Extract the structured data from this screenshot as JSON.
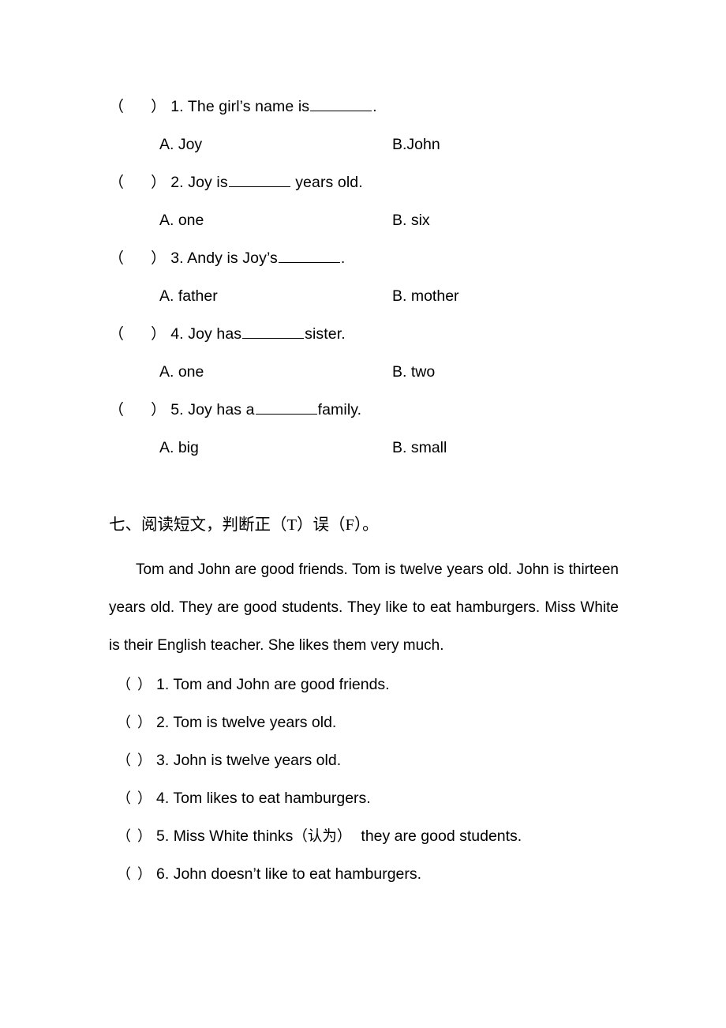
{
  "document": {
    "type": "english-exam-worksheet",
    "background_color": "#ffffff",
    "text_color": "#000000"
  },
  "multiple_choice": {
    "paren_open": "（",
    "paren_close": "）",
    "items": [
      {
        "number": "1.",
        "stem_before": "The girl’s name is",
        "stem_after": ".",
        "option_a": "A. Joy",
        "option_b": "B.John"
      },
      {
        "number": "2.",
        "stem_before": "Joy is",
        "stem_after": "years old.",
        "option_a": "A. one",
        "option_b": "B. six"
      },
      {
        "number": "3.",
        "stem_before": "Andy is Joy’s",
        "stem_after": ".",
        "option_a": "A. father",
        "option_b": "B. mother"
      },
      {
        "number": "4.",
        "stem_before": "Joy has",
        "stem_after": "sister.",
        "option_a": "A. one",
        "option_b": "B. two"
      },
      {
        "number": "5.",
        "stem_before": "Joy has a",
        "stem_after": "family.",
        "option_a": "A. big",
        "option_b": "B. small"
      }
    ]
  },
  "reading_section": {
    "heading": "七、阅读短文，判断正（T）误（F）。",
    "passage": "Tom and John are good friends. Tom is twelve years old. John is thirteen years old. They are good students. They like to eat hamburgers. Miss White is their English teacher. She likes them very much.",
    "paren_open": "（",
    "paren_close": "）",
    "items": [
      {
        "number": "1.",
        "text": "Tom and John are good friends.",
        "gloss_before": "",
        "gloss": "",
        "gloss_after": ""
      },
      {
        "number": "2.",
        "text": "Tom is twelve years old.",
        "gloss_before": "",
        "gloss": "",
        "gloss_after": ""
      },
      {
        "number": "3.",
        "text": "John is twelve years old.",
        "gloss_before": "",
        "gloss": "",
        "gloss_after": ""
      },
      {
        "number": "4.",
        "text": "Tom likes to eat hamburgers.",
        "gloss_before": "",
        "gloss": "",
        "gloss_after": ""
      },
      {
        "number": "5.",
        "text": "",
        "gloss_before": "Miss White thinks",
        "gloss": "（认为）",
        "gloss_after": "they are good students."
      },
      {
        "number": "6.",
        "text": "John doesn’t like to eat hamburgers.",
        "gloss_before": "",
        "gloss": "",
        "gloss_after": ""
      }
    ]
  }
}
